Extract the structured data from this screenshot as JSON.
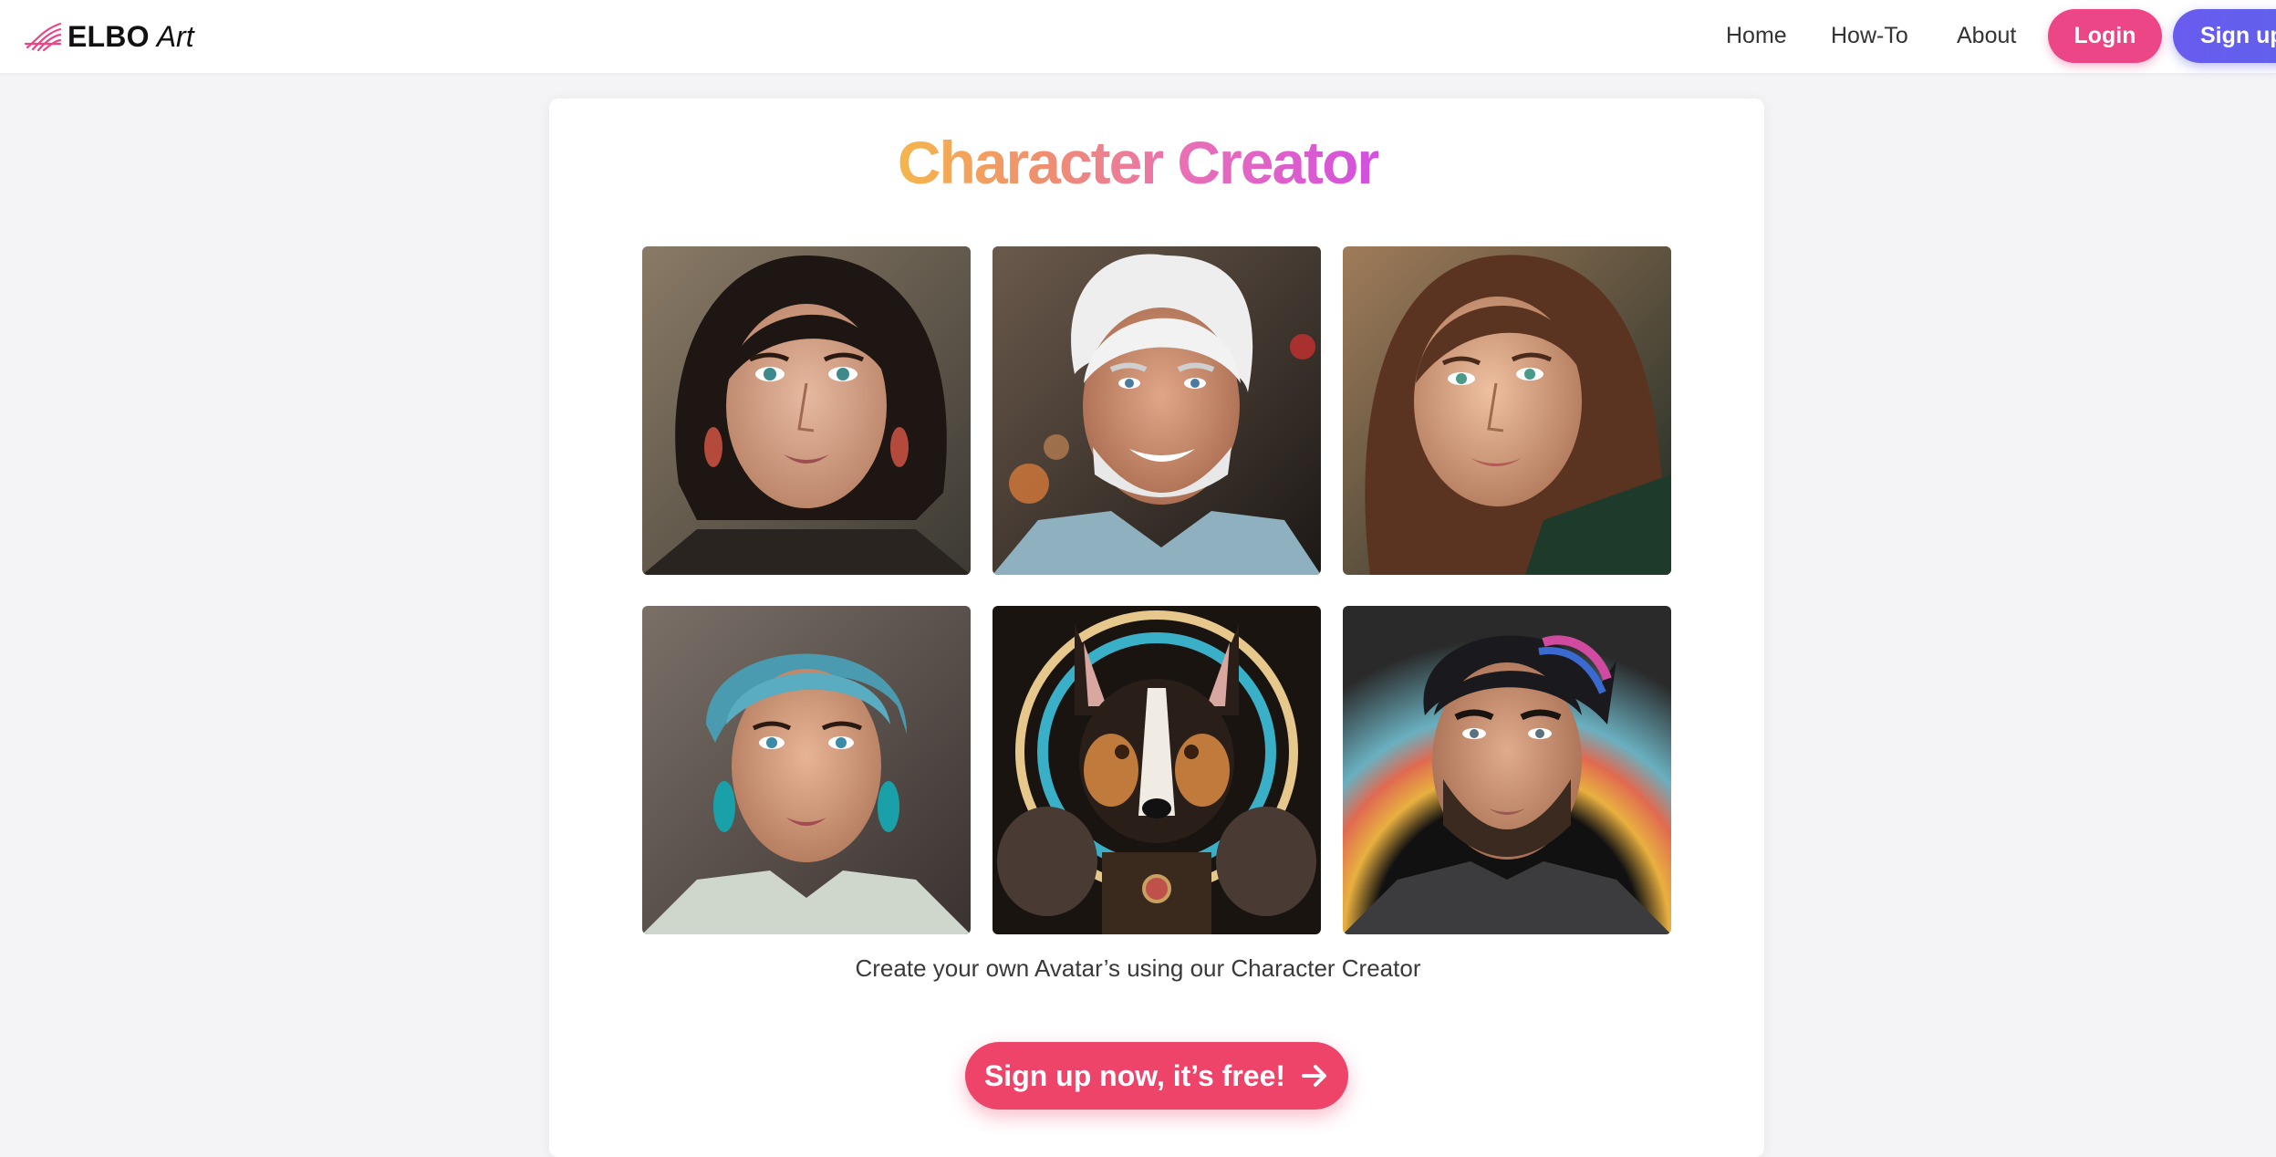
{
  "nav": {
    "brand_name": "ELBO",
    "brand_sub": "Art",
    "links": [
      "Home",
      "How-To",
      "About"
    ],
    "login_label": "Login",
    "signup_label": "Sign up"
  },
  "main": {
    "title": "Character Creator",
    "caption": "Create your own Avatar’s using our Character Creator",
    "cta_label": "Sign up now, it’s free!",
    "gallery": [
      {
        "subject": "woman-dark-bob"
      },
      {
        "subject": "man-white-hair"
      },
      {
        "subject": "woman-brunette"
      },
      {
        "subject": "woman-teal-hair"
      },
      {
        "subject": "dog-portrait"
      },
      {
        "subject": "man-rainbow-hair"
      }
    ]
  },
  "colors": {
    "login": "#ec4687",
    "signup": "#5b63e8",
    "cta": "#ef4469",
    "title_gradient": [
      "#f5b64c",
      "#d34fe0"
    ]
  }
}
